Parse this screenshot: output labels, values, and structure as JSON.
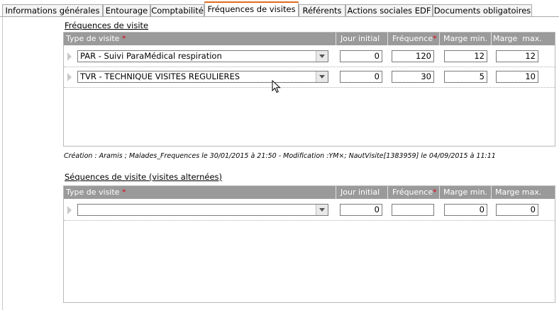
{
  "tabs": [
    {
      "label": "Informations générales",
      "active": false
    },
    {
      "label": "Entourage",
      "active": false
    },
    {
      "label": "Comptabilité",
      "active": false
    },
    {
      "label": "Fréquences de visites",
      "active": true
    },
    {
      "label": "Référents",
      "active": false
    },
    {
      "label": "Actions sociales EDF",
      "active": false
    },
    {
      "label": "Documents obligatoires",
      "active": false
    }
  ],
  "frequencies": {
    "title": "Fréquences de visite",
    "headers": {
      "type": "Type de visite",
      "jour_initial": "Jour initial",
      "frequence": "Fréquence",
      "marge_min": "Marge min.",
      "marge_max": "Marge  max.",
      "required_mark": "*"
    },
    "rows": [
      {
        "type": "PAR - Suivi ParaMédical respiration",
        "jour_initial": "0",
        "frequence": "120",
        "marge_min": "12",
        "marge_max": "12"
      },
      {
        "type": "TVR - TECHNIQUE VISITES REGULIERES",
        "jour_initial": "0",
        "frequence": "30",
        "marge_min": "5",
        "marge_max": "10"
      }
    ]
  },
  "audit_line": "Création : Aramis ; Malades_Frequences le 30/01/2015 à 21:50 - Modification :YM×; NautVisite[1383959] le 04/09/2015 à 11:11",
  "sequences": {
    "title": "Séquences de visite (visites alternées)",
    "headers": {
      "type": "Type de visite",
      "jour_initial": "Jour initial",
      "frequence": "Fréquence",
      "marge_min": "Marge min.",
      "marge_max": "Marge max.",
      "required_mark": "*"
    },
    "rows": [
      {
        "type": "",
        "jour_initial": "0",
        "frequence": "",
        "marge_min": "0",
        "marge_max": "0"
      }
    ]
  },
  "icons": {
    "row_marker": "row-pointer-icon",
    "dropdown": "chevron-down-icon",
    "cursor": "mouse-pointer-icon"
  },
  "colors": {
    "active_tab_accent": "#e36c1c",
    "header_bg": "#9a9a9a",
    "required": "#e2001a"
  }
}
